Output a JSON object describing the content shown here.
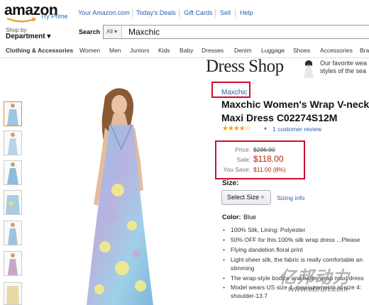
{
  "header": {
    "logo": "amazon",
    "try_prime": "Try Prime",
    "nav": [
      "Your Amazon.com",
      "Today's Deals",
      "Gift Cards",
      "Sell",
      "Help"
    ],
    "shop_by": "Shop by",
    "department": "Department ▾",
    "search_label": "Search",
    "search_scope": "All ▾",
    "search_value": "Maxchic"
  },
  "categories": {
    "main": "Clothing & Accessories",
    "items": [
      "Women",
      "Men",
      "Juniors",
      "Kids",
      "Baby",
      "Dresses",
      "Denim",
      "Luggage",
      "Shoes",
      "Accessories",
      "Bra"
    ]
  },
  "banner": {
    "title": "Dress Shop",
    "tagline_1": "Our favorite wea",
    "tagline_2": "styles of the sea"
  },
  "product": {
    "brand": "Maxchic",
    "title_1": "Maxchic Women's Wrap V-neck",
    "title_2": "Maxi Dress C02274S12M",
    "stars": "★★★★☆",
    "rating_chevron": "▾",
    "reviews": "1 customer review",
    "price_label": "Price:",
    "price": "$236.00",
    "sale_label": "Sale:",
    "sale": "$118.00",
    "save_label": "You Save:",
    "save": "$11.00 (8%)",
    "size_label": "Size:",
    "size_select": "Select Size  ÷",
    "sizing_info": "Sizing info",
    "color_label": "Color:",
    "color_value": "Blue",
    "bullets": [
      "100% Silk, Lining: Polyester",
      "50% OFF for this 100% silk wrap dress ...Please",
      "Flying dandelion floral print",
      "Light sheer silk, the fabric is really comfortable an",
      "slimming",
      "The wrap-style bodice and halter wrap maxi dress",
      "Model wears US size 4, measurements of size 4:",
      "shoulder-13.7"
    ]
  },
  "watermark": {
    "cn": "亿邦动力",
    "url": "www.ebrun.com"
  },
  "colors": {
    "link": "#2a5db0",
    "price_red": "#b12704",
    "highlight_box": "#c8102e",
    "star": "#f0a400"
  }
}
